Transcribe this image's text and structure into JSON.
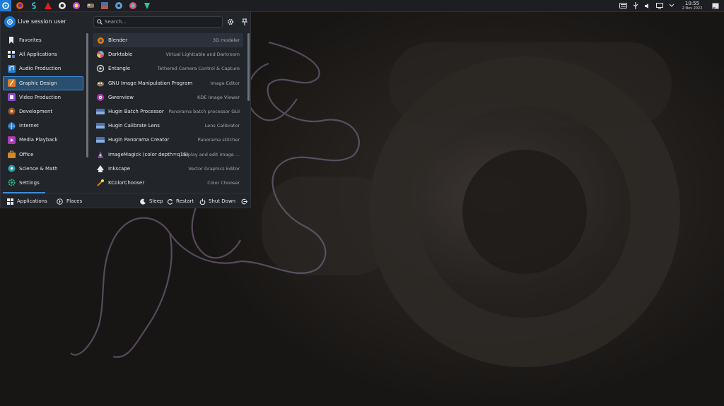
{
  "menu": {
    "user_name": "Live session user",
    "search_placeholder": "Search...",
    "categories": [
      {
        "label": "Favorites",
        "icon": "bookmark-icon"
      },
      {
        "label": "All Applications",
        "icon": "grid-icon"
      },
      {
        "label": "Audio Production",
        "icon": "audio-icon"
      },
      {
        "label": "Graphic Design",
        "icon": "paint-icon"
      },
      {
        "label": "Video Production",
        "icon": "film-icon"
      },
      {
        "label": "Development",
        "icon": "bug-icon"
      },
      {
        "label": "Internet",
        "icon": "globe-icon"
      },
      {
        "label": "Media Playback",
        "icon": "media-icon"
      },
      {
        "label": "Office",
        "icon": "briefcase-icon"
      },
      {
        "label": "Science & Math",
        "icon": "atom-icon"
      },
      {
        "label": "Settings",
        "icon": "gear-icon"
      }
    ],
    "selected_category": "Graphic Design",
    "apps": [
      {
        "name": "Blender",
        "desc": "3D modeler"
      },
      {
        "name": "Darktable",
        "desc": "Virtual Lighttable and Darkroom"
      },
      {
        "name": "Entangle",
        "desc": "Tethered Camera Control & Capture"
      },
      {
        "name": "GNU Image Manipulation Program",
        "desc": "Image Editor"
      },
      {
        "name": "Gwenview",
        "desc": "KDE Image Viewer"
      },
      {
        "name": "Hugin Batch Processor",
        "desc": "Panorama batch processor GUI"
      },
      {
        "name": "Hugin Calibrate Lens",
        "desc": "Lens Calibrator"
      },
      {
        "name": "Hugin Panorama Creator",
        "desc": "Panorama stitcher"
      },
      {
        "name": "ImageMagick (color depth=q16)",
        "desc": "Display and edit image ..."
      },
      {
        "name": "Inkscape",
        "desc": "Vector Graphics Editor"
      },
      {
        "name": "KColorChooser",
        "desc": "Color Chooser"
      }
    ],
    "footer": {
      "tab_applications": "Applications",
      "tab_places": "Places",
      "sleep": "Sleep",
      "restart": "Restart",
      "shutdown": "Shut Down"
    }
  },
  "panel": {
    "time": "10:55",
    "date": "2 Nov 2022"
  },
  "colors": {
    "accent": "#3d8ee0",
    "menu_bg": "#22252a",
    "panel_bg": "#1c1e21"
  }
}
